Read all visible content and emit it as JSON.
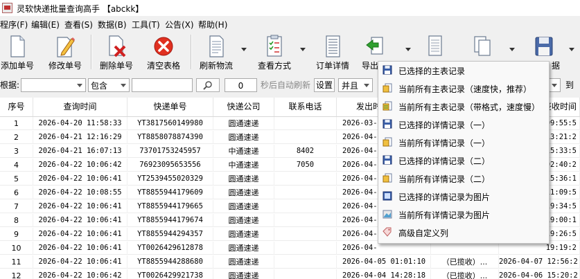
{
  "window": {
    "title": "灵软快递批量查询高手 【abckk】"
  },
  "menu": [
    "程序(F)",
    "编辑(E)",
    "查看(S)",
    "数据(B)",
    "工具(T)",
    "公告(X)",
    "帮助(H)"
  ],
  "toolbar": [
    {
      "label": "添加单号",
      "icon": "document-icon"
    },
    {
      "label": "修改单号",
      "icon": "edit-document-icon"
    },
    {
      "label": "删除单号",
      "icon": "delete-document-icon"
    },
    {
      "label": "清空表格",
      "icon": "clear-icon"
    },
    {
      "label": "刷新物流",
      "icon": "refresh-icon"
    },
    {
      "label": "查看方式",
      "icon": "view-mode-icon"
    },
    {
      "label": "订单详情",
      "icon": "order-detail-icon"
    },
    {
      "label": "导出",
      "icon": "export-icon"
    },
    {
      "label": "",
      "icon": "print-icon"
    },
    {
      "label": "",
      "icon": "copy-icon"
    },
    {
      "label": "据",
      "icon": "save-icon"
    }
  ],
  "filter": {
    "by_label": "根据:",
    "field_value": "",
    "match_value": "包含",
    "keyword_value": "",
    "search_icon": "search-icon",
    "seconds_value": "0",
    "auto_refresh_text": "秒后自动刷新",
    "settings_button": "设置",
    "logic_value": "并且",
    "to_label": "到"
  },
  "table": {
    "columns": [
      "序号",
      "查询时间",
      "快递单号",
      "快递公司",
      "联系电话",
      "发出时",
      "",
      "签收时间"
    ],
    "rows": [
      {
        "no": "1",
        "time": "2026-04-20 11:58:33",
        "tracking": "YT3817560149980",
        "company": "圆通速递",
        "phone": "",
        "sent": "2026-03-",
        "status": "",
        "sign": "09:55:5"
      },
      {
        "no": "2",
        "time": "2026-04-21 12:16:29",
        "tracking": "YT8858078874390",
        "company": "圆通速递",
        "phone": "",
        "sent": "2026-04-",
        "status": "",
        "sign": "13:21:2"
      },
      {
        "no": "3",
        "time": "2026-04-21 16:07:13",
        "tracking": "73701753245957",
        "company": "中通速递",
        "phone": "8402",
        "sent": "2026-04-",
        "status": "",
        "sign": "15:33:5"
      },
      {
        "no": "4",
        "time": "2026-04-22 10:06:42",
        "tracking": "76923095653556",
        "company": "中通速递",
        "phone": "7050",
        "sent": "2026-04-",
        "status": "",
        "sign": "02:40:2"
      },
      {
        "no": "5",
        "time": "2026-04-22 10:06:41",
        "tracking": "YT2539455020329",
        "company": "圆通速递",
        "phone": "",
        "sent": "2026-04-",
        "status": "",
        "sign": "15:36:1"
      },
      {
        "no": "6",
        "time": "2026-04-22 10:08:55",
        "tracking": "YT8855944179609",
        "company": "圆通速递",
        "phone": "",
        "sent": "2026-04-",
        "status": "",
        "sign": "11:09:5"
      },
      {
        "no": "7",
        "time": "2026-04-22 10:06:41",
        "tracking": "YT8855944179665",
        "company": "圆通速递",
        "phone": "",
        "sent": "2026-04-",
        "status": "",
        "sign": "19:34:5"
      },
      {
        "no": "8",
        "time": "2026-04-22 10:06:41",
        "tracking": "YT8855944179674",
        "company": "圆通速递",
        "phone": "",
        "sent": "2026-04-",
        "status": "",
        "sign": "19:00:1"
      },
      {
        "no": "9",
        "time": "2026-04-22 10:06:41",
        "tracking": "YT8855944294357",
        "company": "圆通速递",
        "phone": "",
        "sent": "2026-04-",
        "status": "",
        "sign": "19:26:5"
      },
      {
        "no": "10",
        "time": "2026-04-22 10:06:41",
        "tracking": "YT0026429612878",
        "company": "圆通速递",
        "phone": "",
        "sent": "2026-04-",
        "status": "",
        "sign": "19:19:2"
      },
      {
        "no": "11",
        "time": "2026-04-22 10:06:41",
        "tracking": "YT8855944288680",
        "company": "圆通速递",
        "phone": "",
        "sent": "2026-04-05 01:01:10",
        "status": "（已揽收）...",
        "sign": "2026-04-07 12:56:2"
      },
      {
        "no": "12",
        "time": "2026-04-22 10:06:42",
        "tracking": "YT0026429921738",
        "company": "圆通速递",
        "phone": "",
        "sent": "2026-04-04 14:28:18",
        "status": "（已揽收）...",
        "sign": "2026-04-06 15:20:2"
      }
    ]
  },
  "export_menu": [
    {
      "label": "已选择的主表记录",
      "icon": "save-disk-icon"
    },
    {
      "label": "当前所有主表记录（速度快，推荐）",
      "icon": "export-all-icon"
    },
    {
      "label": "当前所有主表记录（带格式，速度慢）",
      "icon": "export-format-icon"
    },
    {
      "label": "已选择的详情记录（一）",
      "icon": "save-disk-icon"
    },
    {
      "label": "当前所有详情记录（一）",
      "icon": "export-all-icon"
    },
    {
      "label": "已选择的详情记录（二）",
      "icon": "save-disk-icon"
    },
    {
      "label": "当前所有详情记录（二）",
      "icon": "export-all-icon"
    },
    {
      "label": "已选择的详情记录为图片",
      "icon": "save-image-icon"
    },
    {
      "label": "当前所有详情记录为图片",
      "icon": "export-image-icon"
    },
    {
      "label": "高级自定义列",
      "icon": "tag-icon"
    }
  ]
}
